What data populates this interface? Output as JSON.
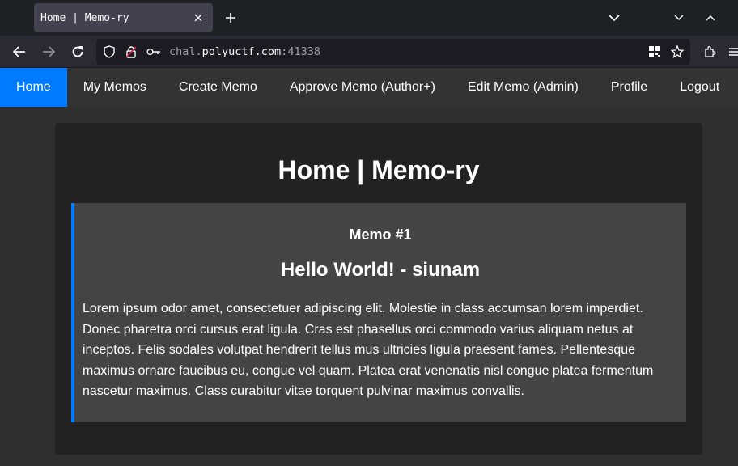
{
  "browser": {
    "tab_title": "Home | Memo-ry",
    "url_prefix": "chal.",
    "url_host": "polyuctf.com",
    "url_port": ":41338"
  },
  "nav": {
    "items": [
      {
        "label": "Home",
        "active": true
      },
      {
        "label": "My Memos"
      },
      {
        "label": "Create Memo"
      },
      {
        "label": "Approve Memo (Author+)"
      },
      {
        "label": "Edit Memo (Admin)"
      },
      {
        "label": "Profile"
      },
      {
        "label": "Logout"
      }
    ]
  },
  "main": {
    "title": "Home | Memo-ry",
    "memo": {
      "number": "Memo #1",
      "title": "Hello World! - siunam",
      "body": "Lorem ipsum odor amet, consectetuer adipiscing elit. Molestie in class accumsan lorem imperdiet. Donec pharetra orci cursus erat ligula. Cras est phasellus orci commodo varius aliquam netus at inceptos. Felis sodales volutpat hendrerit tellus mus ultricies ligula praesent fames. Pellentesque maximus ornare faucibus eu, congue vel quam. Platea erat venenatis nisl congue platea fermentum nascetur maximus. Class curabitur vitae torquent pulvinar maximus convallis."
    }
  },
  "colors": {
    "accent": "#007bff",
    "nav_bg": "#333333",
    "page_bg": "#2f2f2f",
    "container_bg": "#222222",
    "memo_bg": "#444444"
  },
  "icons": [
    "close-icon",
    "plus-icon",
    "chevron-down-icon",
    "chevron-up-icon",
    "back-arrow-icon",
    "forward-arrow-icon",
    "reload-icon",
    "shield-icon",
    "lock-icon",
    "key-icon",
    "qr-code-icon",
    "star-icon",
    "extensions-icon",
    "menu-icon"
  ]
}
